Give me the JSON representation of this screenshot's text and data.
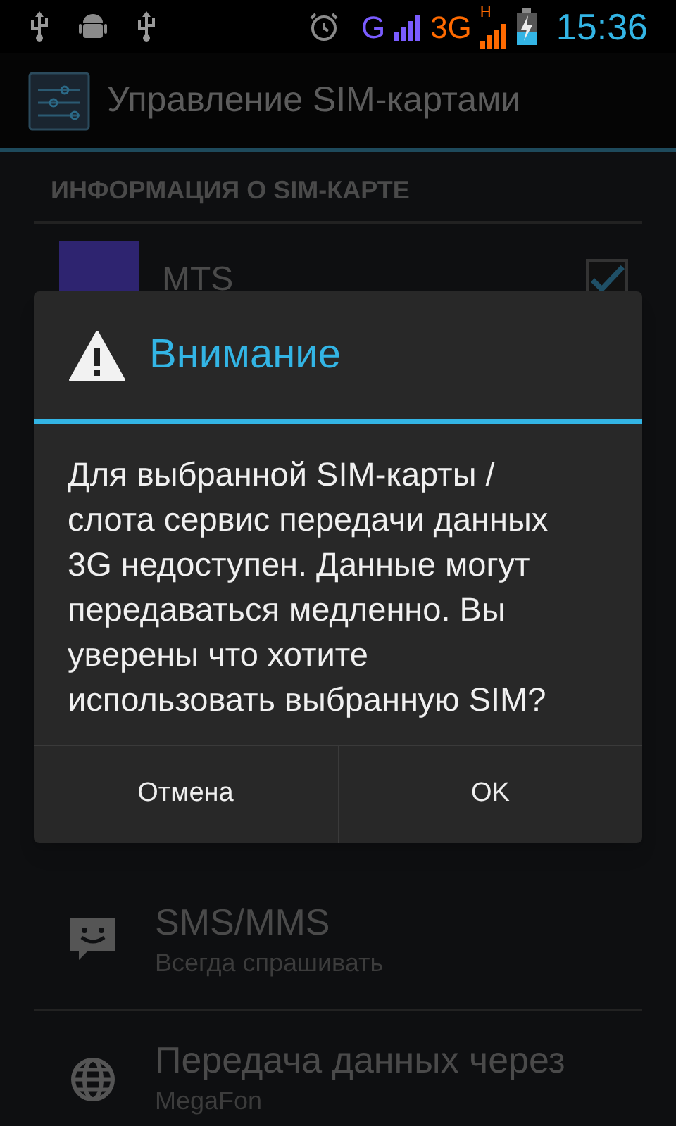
{
  "status_bar": {
    "network_1": "G",
    "network_2": "3G",
    "network_2_badge": "H",
    "time": "15:36"
  },
  "header": {
    "title": "Управление SIM-картами"
  },
  "section": {
    "title": "ИНФОРМАЦИЯ О SIM-КАРТЕ"
  },
  "sims": [
    {
      "name": "MTS",
      "color": "#2e2470",
      "checked": true
    }
  ],
  "settings": [
    {
      "kind": "sms",
      "title": "SMS/MMS",
      "subtitle": "Всегда спрашивать"
    },
    {
      "kind": "data",
      "title": "Передача данных через",
      "subtitle": "MegaFon"
    }
  ],
  "dialog": {
    "title": "Внимание",
    "message": "Для выбранной SIM-карты / слота сервис передачи данных 3G недоступен. Данные могут передаваться медленно. Вы уверены что хотите использовать выбранную SIM?",
    "buttons": [
      "Отмена",
      "OK"
    ]
  }
}
